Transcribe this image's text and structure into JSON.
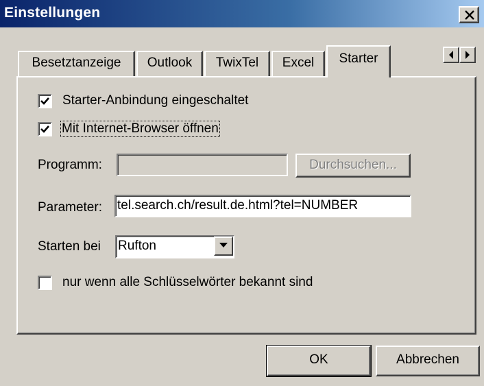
{
  "window": {
    "title": "Einstellungen",
    "close_icon": "close-icon"
  },
  "tabs": [
    {
      "label": "Besetztanzeige",
      "active": false
    },
    {
      "label": "Outlook",
      "active": false
    },
    {
      "label": "TwixTel",
      "active": false
    },
    {
      "label": "Excel",
      "active": false
    },
    {
      "label": "Starter",
      "active": true
    }
  ],
  "tab_scroll": {
    "left_icon": "triangle-left-icon",
    "right_icon": "triangle-right-icon"
  },
  "starter": {
    "enable": {
      "label": "Starter-Anbindung eingeschaltet",
      "checked": true
    },
    "browser": {
      "label": "Mit Internet-Browser öffnen",
      "checked": true
    },
    "program": {
      "label": "Programm:",
      "value": "",
      "browse_label": "Durchsuchen...",
      "disabled": true
    },
    "parameter": {
      "label": "Parameter:",
      "value": "tel.search.ch/result.de.html?tel=NUMBER"
    },
    "start_on": {
      "label": "Starten bei",
      "value": "Rufton"
    },
    "only_known": {
      "label": "nur wenn alle Schlüsselwörter bekannt sind",
      "checked": false
    }
  },
  "footer": {
    "ok_label": "OK",
    "cancel_label": "Abbrechen"
  }
}
